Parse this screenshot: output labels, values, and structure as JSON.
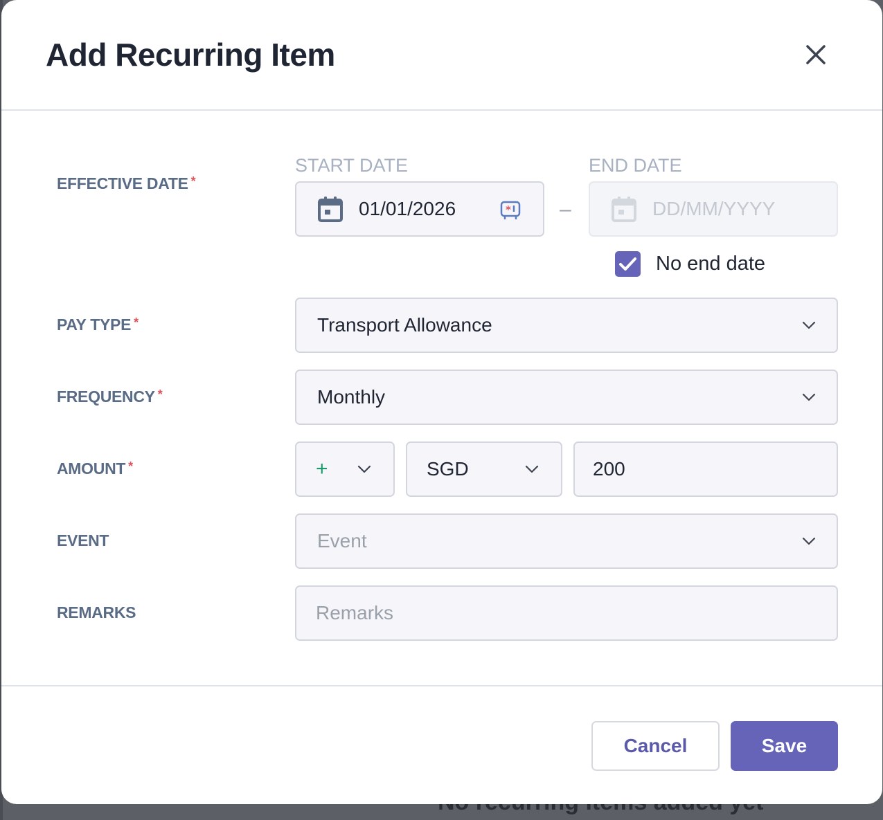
{
  "background": {
    "partial_text": "No recurring items added yet"
  },
  "modal": {
    "title": "Add Recurring Item"
  },
  "effective_date": {
    "label": "EFFECTIVE DATE",
    "start_label": "START DATE",
    "start_value": "01/01/2026",
    "end_label": "END DATE",
    "end_placeholder": "DD/MM/YYYY",
    "separator": "–",
    "no_end_date_label": "No end date",
    "no_end_date_checked": true
  },
  "pay_type": {
    "label": "PAY TYPE",
    "value": "Transport Allowance"
  },
  "frequency": {
    "label": "FREQUENCY",
    "value": "Monthly"
  },
  "amount": {
    "label": "AMOUNT",
    "sign": "+",
    "currency": "SGD",
    "value": "200"
  },
  "event": {
    "label": "EVENT",
    "placeholder": "Event"
  },
  "remarks": {
    "label": "REMARKS",
    "placeholder": "Remarks"
  },
  "required_marker": "*",
  "footer": {
    "cancel_label": "Cancel",
    "save_label": "Save"
  },
  "colors": {
    "accent": "#6664b8",
    "required": "#e0525a",
    "label": "#5a6b86"
  }
}
